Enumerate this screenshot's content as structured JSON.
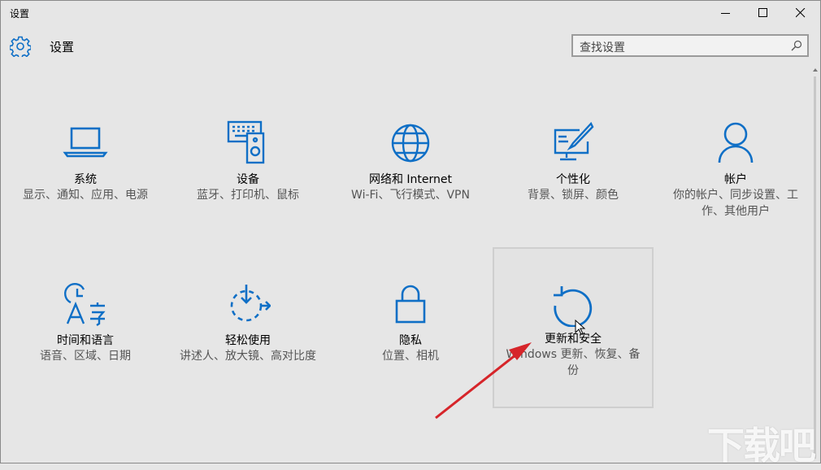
{
  "window": {
    "title": "设置",
    "controls": [
      "minimize",
      "maximize",
      "close"
    ]
  },
  "header": {
    "title": "设置",
    "icon": "gear-icon"
  },
  "search": {
    "placeholder": "查找设置",
    "icon": "search-icon"
  },
  "colors": {
    "accent": "#0f6fc6",
    "background": "#e6e6e6",
    "annotation_arrow": "#d6252a"
  },
  "tiles": [
    {
      "label": "系统",
      "desc": "显示、通知、应用、电源",
      "icon": "laptop-icon"
    },
    {
      "label": "设备",
      "desc": "蓝牙、打印机、鼠标",
      "icon": "devices-icon"
    },
    {
      "label": "网络和 Internet",
      "desc": "Wi-Fi、飞行模式、VPN",
      "icon": "globe-icon"
    },
    {
      "label": "个性化",
      "desc": "背景、锁屏、颜色",
      "icon": "personalization-icon"
    },
    {
      "label": "帐户",
      "desc": "你的帐户、同步设置、工作、其他用户",
      "icon": "person-icon"
    },
    {
      "label": "时间和语言",
      "desc": "语音、区域、日期",
      "icon": "time-language-icon"
    },
    {
      "label": "轻松使用",
      "desc": "讲述人、放大镜、高对比度",
      "icon": "ease-of-access-icon"
    },
    {
      "label": "隐私",
      "desc": "位置、相机",
      "icon": "lock-icon"
    },
    {
      "label": "更新和安全",
      "desc": "Windows 更新、恢复、备份",
      "icon": "refresh-icon",
      "highlighted": true
    }
  ],
  "watermark": "下载吧"
}
